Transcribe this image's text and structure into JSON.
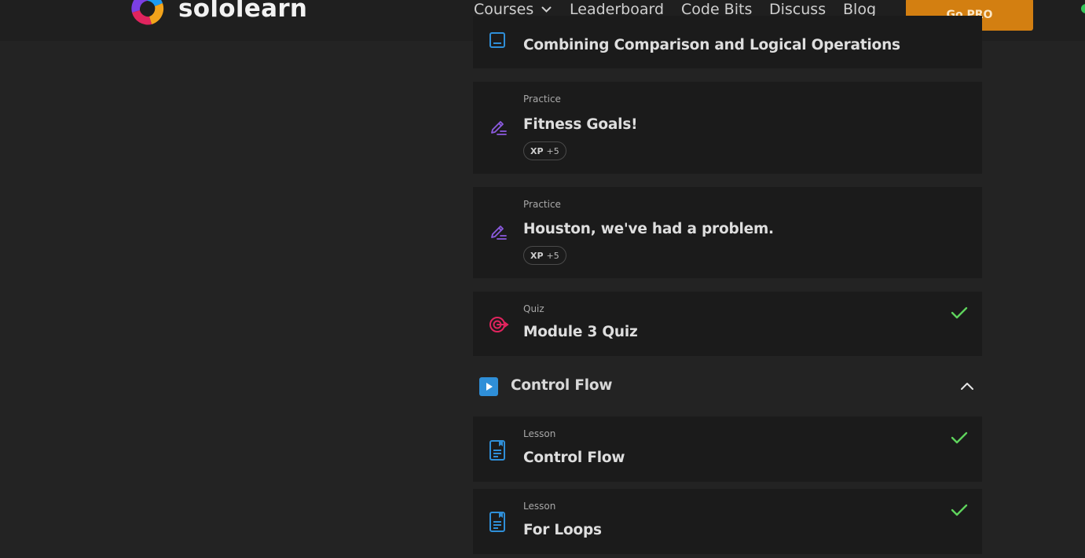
{
  "nav": {
    "logo_text": "sololearn",
    "links": [
      "Courses",
      "Leaderboard",
      "Code Bits",
      "Discuss",
      "Blog"
    ],
    "cta": "Go PRO"
  },
  "items": [
    {
      "category": "",
      "title": "Combining Comparison and Logical Operations",
      "icon": "lesson-icon"
    },
    {
      "category": "Practice",
      "title": "Fitness Goals!",
      "xp_label": "XP",
      "xp_value": "+5",
      "icon": "pencil-icon"
    },
    {
      "category": "Practice",
      "title": "Houston, we've had a problem.",
      "xp_label": "XP",
      "xp_value": "+5",
      "icon": "pencil-icon"
    },
    {
      "category": "Quiz",
      "title": "Module 3 Quiz",
      "icon": "target-icon",
      "completed": true
    }
  ],
  "section": {
    "title": "Control Flow",
    "icon": "play-icon",
    "expanded": true
  },
  "section_items": [
    {
      "category": "Lesson",
      "title": "Control Flow",
      "icon": "lesson-icon",
      "completed": true
    },
    {
      "category": "Lesson",
      "title": "For Loops",
      "icon": "lesson-icon",
      "completed": true
    }
  ],
  "colors": {
    "background": "#232323",
    "card": "#1b1b1b",
    "accent_orange": "#d37f11",
    "check_green": "#5fd35c",
    "lesson_blue": "#2f8fd8",
    "practice_purple": "#8c5be0",
    "quiz_red": "#e0245e"
  }
}
